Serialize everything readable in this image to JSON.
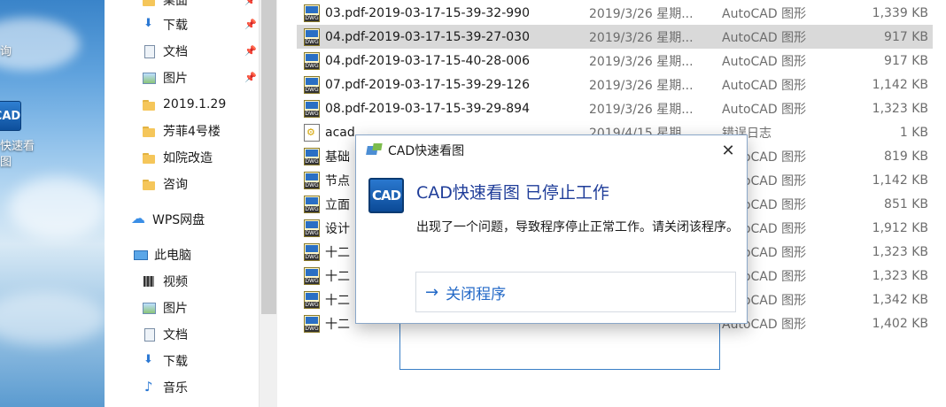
{
  "desktop": {
    "labels": [
      "询",
      "快速看",
      "图"
    ],
    "cad_icon_text": "CAD"
  },
  "nav": {
    "items": [
      {
        "label": "桌面",
        "icon": "folder-icon",
        "pinned": true
      },
      {
        "label": "下载",
        "icon": "download-icon",
        "pinned": true
      },
      {
        "label": "文档",
        "icon": "document-icon",
        "pinned": true
      },
      {
        "label": "图片",
        "icon": "picture-icon",
        "pinned": true
      },
      {
        "label": "2019.1.29",
        "icon": "folder-icon",
        "pinned": false
      },
      {
        "label": "芳菲4号楼",
        "icon": "folder-icon",
        "pinned": false
      },
      {
        "label": "如院改造",
        "icon": "folder-icon",
        "pinned": false
      },
      {
        "label": "咨询",
        "icon": "folder-icon",
        "pinned": false
      },
      {
        "label": "WPS网盘",
        "icon": "cloud-icon",
        "pinned": false
      },
      {
        "label": "此电脑",
        "icon": "computer-icon",
        "pinned": false
      },
      {
        "label": "视频",
        "icon": "video-icon",
        "pinned": false
      },
      {
        "label": "图片",
        "icon": "picture-icon",
        "pinned": false
      },
      {
        "label": "文档",
        "icon": "document-icon",
        "pinned": false
      },
      {
        "label": "下载",
        "icon": "download-icon",
        "pinned": false
      },
      {
        "label": "音乐",
        "icon": "music-icon",
        "pinned": false
      }
    ],
    "pin_glyph": "📌"
  },
  "files": [
    {
      "name": "03.pdf-2019-03-17-15-39-32-990",
      "date": "2019/3/26 星期...",
      "type": "AutoCAD 图形",
      "size": "1,339 KB",
      "icon": "dwg",
      "selected": false
    },
    {
      "name": "04.pdf-2019-03-17-15-39-27-030",
      "date": "2019/3/26 星期...",
      "type": "AutoCAD 图形",
      "size": "917 KB",
      "icon": "dwg",
      "selected": true
    },
    {
      "name": "04.pdf-2019-03-17-15-40-28-006",
      "date": "2019/3/26 星期...",
      "type": "AutoCAD 图形",
      "size": "917 KB",
      "icon": "dwg",
      "selected": false
    },
    {
      "name": "07.pdf-2019-03-17-15-39-29-126",
      "date": "2019/3/26 星期...",
      "type": "AutoCAD 图形",
      "size": "1,142 KB",
      "icon": "dwg",
      "selected": false
    },
    {
      "name": "08.pdf-2019-03-17-15-39-29-894",
      "date": "2019/3/26 星期...",
      "type": "AutoCAD 图形",
      "size": "1,323 KB",
      "icon": "dwg",
      "selected": false
    },
    {
      "name": "acad",
      "date": "2019/4/15 星期...",
      "type": "错误日志",
      "size": "1 KB",
      "icon": "log",
      "selected": false
    },
    {
      "name": "基础",
      "date": "",
      "type": "AutoCAD 图形",
      "size": "819 KB",
      "icon": "dwg",
      "selected": false
    },
    {
      "name": "节点",
      "date": "",
      "type": "AutoCAD 图形",
      "size": "1,142 KB",
      "icon": "dwg",
      "selected": false
    },
    {
      "name": "立面",
      "date": "",
      "type": "AutoCAD 图形",
      "size": "851 KB",
      "icon": "dwg",
      "selected": false
    },
    {
      "name": "设计",
      "date": "",
      "type": "AutoCAD 图形",
      "size": "1,912 KB",
      "icon": "dwg",
      "selected": false
    },
    {
      "name": "十二",
      "date": "",
      "type": "AutoCAD 图形",
      "size": "1,323 KB",
      "icon": "dwg",
      "selected": false
    },
    {
      "name": "十二",
      "date": "",
      "type": "AutoCAD 图形",
      "size": "1,323 KB",
      "icon": "dwg",
      "selected": false
    },
    {
      "name": "十二",
      "date": "",
      "type": "AutoCAD 图形",
      "size": "1,342 KB",
      "icon": "dwg",
      "selected": false
    },
    {
      "name": "十二",
      "date": "",
      "type": "AutoCAD 图形",
      "size": "1,402 KB",
      "icon": "dwg",
      "selected": false
    }
  ],
  "dialog": {
    "title": "CAD快速看图",
    "close_glyph": "✕",
    "icon_text": "CAD",
    "heading": "CAD快速看图 已停止工作",
    "message": "出现了一个问题，导致程序停止正常工作。请关闭该程序。",
    "button_arrow": "→",
    "button_label": "关闭程序"
  }
}
